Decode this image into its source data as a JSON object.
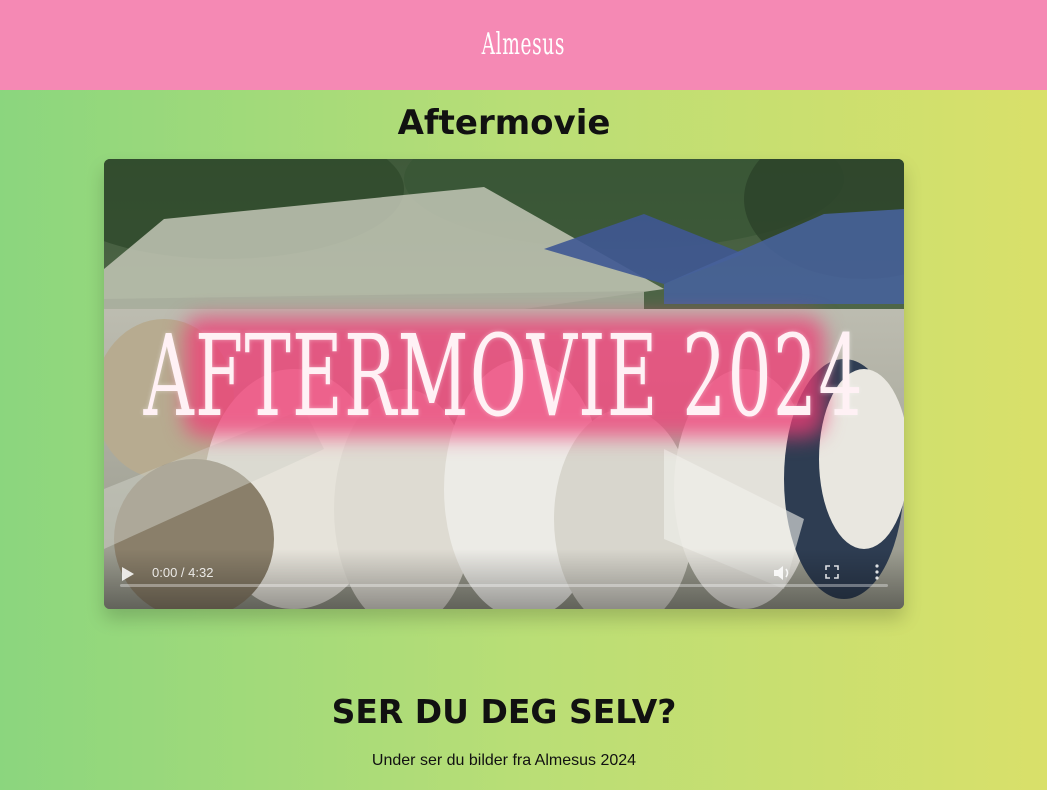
{
  "header": {
    "logo_text": "Almesus",
    "background_color": "#f589b4"
  },
  "aftermovie": {
    "heading": "Aftermovie",
    "video": {
      "overlay_text": "AFTERMOVIE 2024",
      "time": "0:00 / 4:32",
      "progress_fraction": 0,
      "icons": {
        "play": "play-icon",
        "volume": "volume-icon",
        "fullscreen": "fullscreen-icon",
        "more": "more-options-icon"
      }
    }
  },
  "gallery": {
    "heading": "SER DU DEG SELV?",
    "subtitle": "Under ser du bilder fra Almesus 2024"
  },
  "colors": {
    "gradient_left": "#8bd67e",
    "gradient_right": "#d9e06a",
    "overlay_pink": "#ee3e76"
  }
}
